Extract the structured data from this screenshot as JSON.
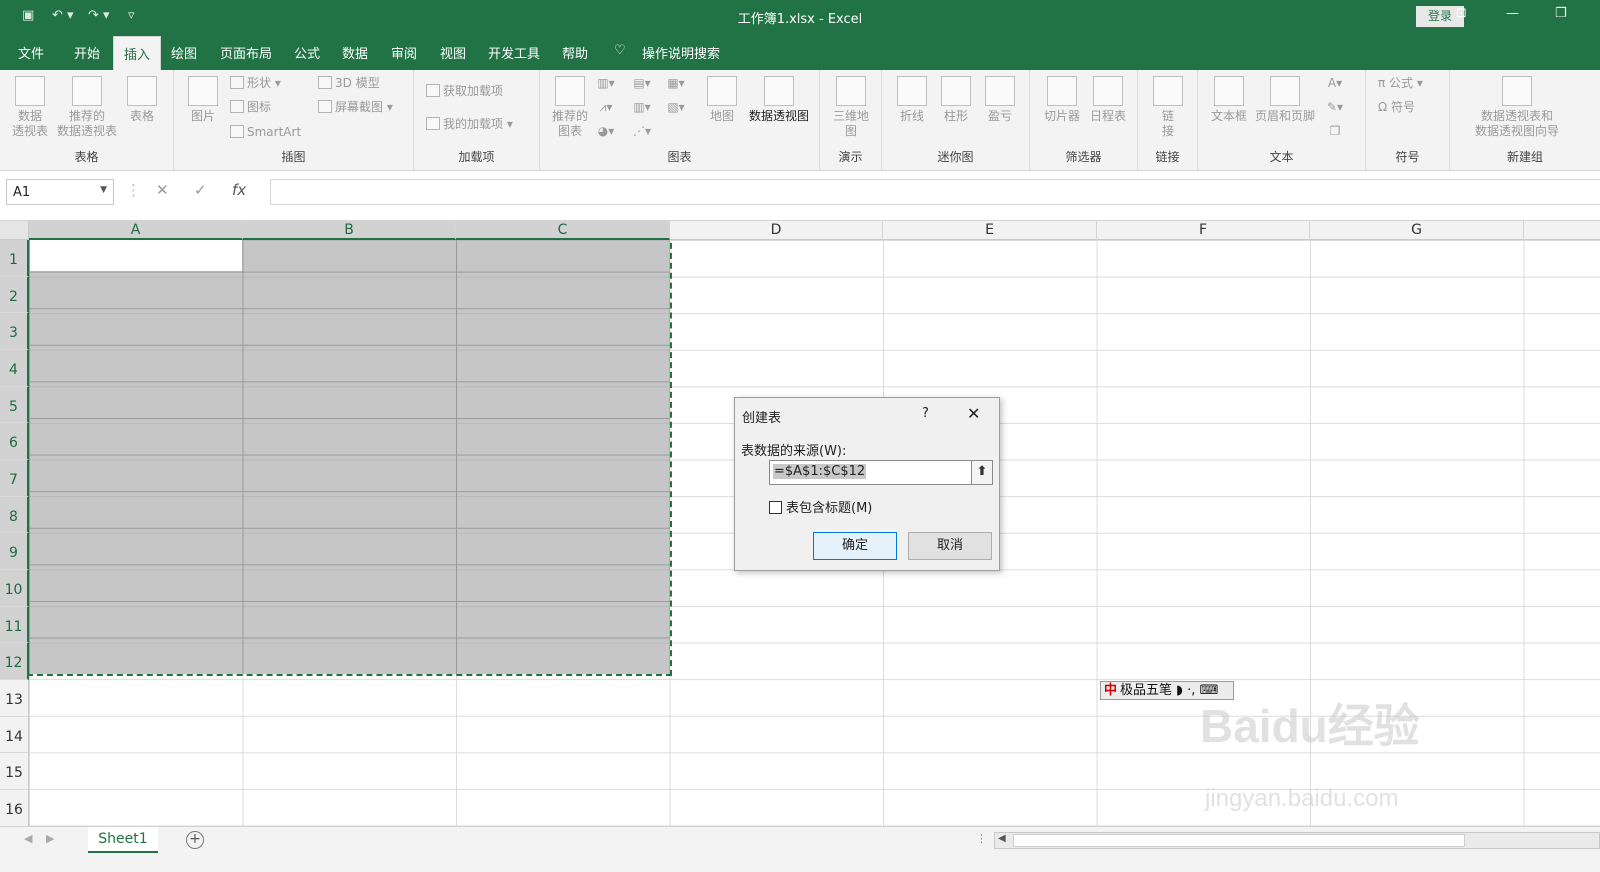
{
  "titlebar": {
    "title": "工作簿1.xlsx  -  Excel",
    "login": "登录",
    "qa_icons": [
      "save-icon",
      "undo-icon",
      "redo-icon",
      "customize-icon"
    ]
  },
  "tabs": [
    "文件",
    "开始",
    "插入",
    "绘图",
    "页面布局",
    "公式",
    "数据",
    "审阅",
    "视图",
    "开发工具",
    "帮助",
    "操作说明搜索"
  ],
  "active_tab": "插入",
  "ribbon": {
    "groups": [
      {
        "label": "表格",
        "items": [
          "数据\n透视表",
          "推荐的\n数据透视表",
          "表格"
        ]
      },
      {
        "label": "插图",
        "items": [
          "图片",
          "形状",
          "图标",
          "SmartArt",
          "3D 模型",
          "屏幕截图"
        ]
      },
      {
        "label": "加载项",
        "items": [
          "获取加载项",
          "我的加载项"
        ]
      },
      {
        "label": "图表",
        "items": [
          "推荐的\n图表",
          "地图",
          "数据透视图"
        ]
      },
      {
        "label": "演示",
        "items": [
          "三维地\n图"
        ]
      },
      {
        "label": "迷你图",
        "items": [
          "折线",
          "柱形",
          "盈亏"
        ]
      },
      {
        "label": "筛选器",
        "items": [
          "切片器",
          "日程表"
        ]
      },
      {
        "label": "链接",
        "items": [
          "链\n接"
        ]
      },
      {
        "label": "文本",
        "items": [
          "文本框",
          "页眉和页脚"
        ]
      },
      {
        "label": "符号",
        "items": [
          "公式",
          "符号"
        ]
      },
      {
        "label": "新建组",
        "items": [
          "数据透视表和\n数据透视图向导"
        ]
      }
    ]
  },
  "formula_bar": {
    "name_box": "A1",
    "value": ""
  },
  "columns": [
    "A",
    "B",
    "C",
    "D",
    "E",
    "F",
    "G"
  ],
  "rows": [
    "1",
    "2",
    "3",
    "4",
    "5",
    "6",
    "7",
    "8",
    "9",
    "10",
    "11",
    "12",
    "13",
    "14",
    "15",
    "16"
  ],
  "selection": "A1:C12",
  "dialog": {
    "title": "创建表",
    "help": "?",
    "source_label": "表数据的来源(W):",
    "source_value": "=$A$1:$C$12",
    "has_headers_label": "表包含标题(M)",
    "has_headers_checked": false,
    "ok": "确定",
    "cancel": "取消"
  },
  "sheet_tab": "Sheet1",
  "ime": {
    "label": "极品五笔",
    "zh": "中"
  },
  "watermark": {
    "main": "Baidu经验",
    "url": "jingyan.baidu.com"
  },
  "colors": {
    "accent": "#217346",
    "ribbon_bg": "#f3f3f3",
    "selection_fill": "#bfbfbf"
  }
}
